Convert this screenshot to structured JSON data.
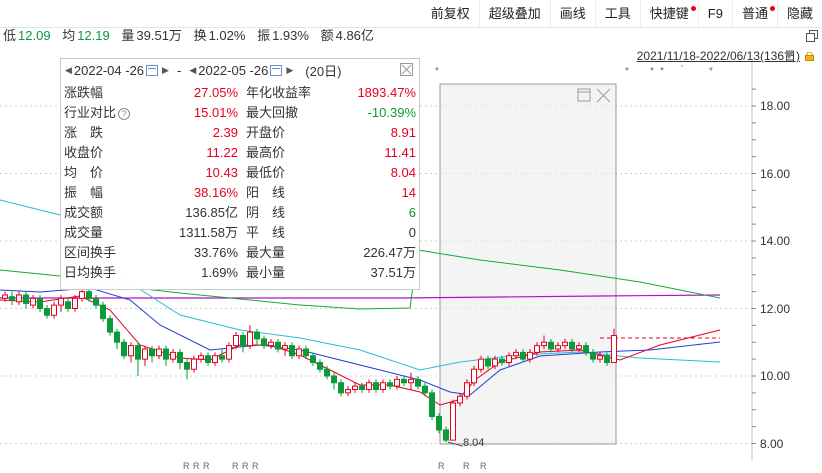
{
  "menu": [
    {
      "label": "前复权",
      "dot": false
    },
    {
      "label": "超级叠加",
      "dot": false
    },
    {
      "label": "画线",
      "dot": false
    },
    {
      "label": "工具",
      "dot": false
    },
    {
      "label": "快捷键",
      "dot": true
    },
    {
      "label": "F9",
      "dot": false
    },
    {
      "label": "普通",
      "dot": true
    },
    {
      "label": "隐藏",
      "dot": false
    }
  ],
  "quote": {
    "low_label": "低",
    "low": "12.09",
    "avg_label": "均",
    "avg": "12.19",
    "vol_label": "量",
    "vol": "39.51万",
    "turn_label": "换",
    "turn": "1.02%",
    "amp_label": "振",
    "amp": "1.93%",
    "amt_label": "额",
    "amt": "4.86亿"
  },
  "range": "2021/11/18-2022/06/13(136日)",
  "panel": {
    "start": "2022-04 -26",
    "sep": "-",
    "end": "2022-05 -26",
    "days": "(20日)",
    "rows": [
      {
        "l": "涨跌幅",
        "lv": "27.05%",
        "lc": "red",
        "r": "年化收益率",
        "rv": "1893.47%",
        "rc": "red",
        "q": false
      },
      {
        "l": "行业对比",
        "lv": "15.01%",
        "lc": "red",
        "r": "最大回撤",
        "rv": "-10.39%",
        "rc": "green",
        "q": true
      },
      {
        "l": "涨　跌",
        "lv": "2.39",
        "lc": "red",
        "r": "开盘价",
        "rv": "8.91",
        "rc": "red",
        "q": false
      },
      {
        "l": "收盘价",
        "lv": "11.22",
        "lc": "red",
        "r": "最高价",
        "rv": "11.41",
        "rc": "red",
        "q": false
      },
      {
        "l": "均　价",
        "lv": "10.43",
        "lc": "red",
        "r": "最低价",
        "rv": "8.04",
        "rc": "red",
        "q": false
      },
      {
        "l": "振　幅",
        "lv": "38.16%",
        "lc": "red",
        "r": "阳　线",
        "rv": "14",
        "rc": "red",
        "q": false
      },
      {
        "l": "成交额",
        "lv": "136.85亿",
        "lc": "black",
        "r": "阴　线",
        "rv": "6",
        "rc": "green",
        "q": false
      },
      {
        "l": "成交量",
        "lv": "1311.58万",
        "lc": "black",
        "r": "平　线",
        "rv": "0",
        "rc": "black",
        "q": false
      },
      {
        "l": "区间换手",
        "lv": "33.76%",
        "lc": "black",
        "r": "最大量",
        "rv": "226.47万",
        "rc": "black",
        "q": false
      },
      {
        "l": "日均换手",
        "lv": "1.69%",
        "lc": "black",
        "r": "最小量",
        "rv": "37.51万",
        "rc": "black",
        "q": false
      }
    ]
  },
  "chart_data": {
    "type": "candlestick",
    "y_ticks": [
      "18.00",
      "16.00",
      "14.00",
      "12.00",
      "10.00",
      "8.00"
    ],
    "y_values": [
      18,
      16,
      14,
      12,
      10,
      8
    ],
    "low_marker": "8.04",
    "ma_colors": {
      "ma5": "#e6001f",
      "ma10": "#1e3fd6",
      "ma20": "#2bbbd8",
      "ma60": "#18a83a",
      "ma120": "#b012c8"
    },
    "up_color": "#e6001f",
    "down_color": "#0a9a3a"
  }
}
